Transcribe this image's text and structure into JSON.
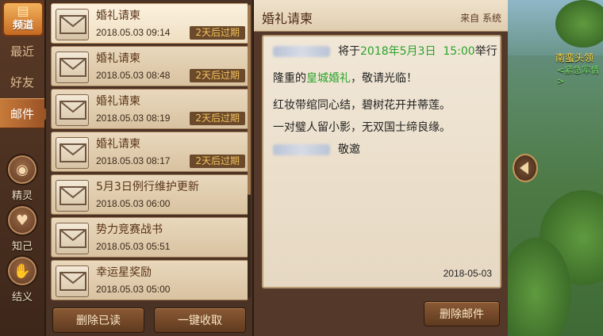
{
  "rail": {
    "channel_label": "频道",
    "tabs": [
      {
        "label": "最近"
      },
      {
        "label": "好友"
      },
      {
        "label": "邮件"
      }
    ],
    "round_buttons": [
      {
        "label": "精灵",
        "icon": "sprite-icon"
      },
      {
        "label": "知己",
        "icon": "heart-icon"
      },
      {
        "label": "结义",
        "icon": "handshake-icon"
      }
    ]
  },
  "mails": [
    {
      "subject": "婚礼请柬",
      "time": "2018.05.03  09:14",
      "expire": "2天后过期"
    },
    {
      "subject": "婚礼请柬",
      "time": "2018.05.03  08:48",
      "expire": "2天后过期"
    },
    {
      "subject": "婚礼请柬",
      "time": "2018.05.03  08:19",
      "expire": "2天后过期"
    },
    {
      "subject": "婚礼请柬",
      "time": "2018.05.03  08:17",
      "expire": "2天后过期"
    },
    {
      "subject": "5月3日例行维护更新",
      "time": "2018.05.03  06:00"
    },
    {
      "subject": "势力竞赛战书",
      "time": "2018.05.03  05:51"
    },
    {
      "subject": "幸运星奖励",
      "time": "2018.05.03  05:00"
    }
  ],
  "list_buttons": {
    "delete_read": "删除已读",
    "collect_all": "一键收取"
  },
  "detail": {
    "title": "婚礼请柬",
    "from": "来自 系统",
    "line1_prefix": "将于",
    "line1_date": "2018年5月3日",
    "line1_time": "15:00",
    "line1_suffix": "举行",
    "line2_prefix": "隆重的",
    "line2_event": "皇城婚礼",
    "line2_suffix": "，敬请光临！",
    "line3": "红妆带绾同心结，碧树花开并蒂莲。",
    "line4": "一对璧人留小影，无双国士缔良缘。",
    "line5": "敬邀",
    "date": "2018-05-03",
    "delete_button": "删除邮件"
  },
  "scene": {
    "npc_name": "南蛮头领",
    "npc_sub": "<紧急军情>"
  },
  "colors": {
    "accent_green": "#2aa32a",
    "expire_yellow": "#f3c15c",
    "npc_yellow": "#ffe14f"
  }
}
